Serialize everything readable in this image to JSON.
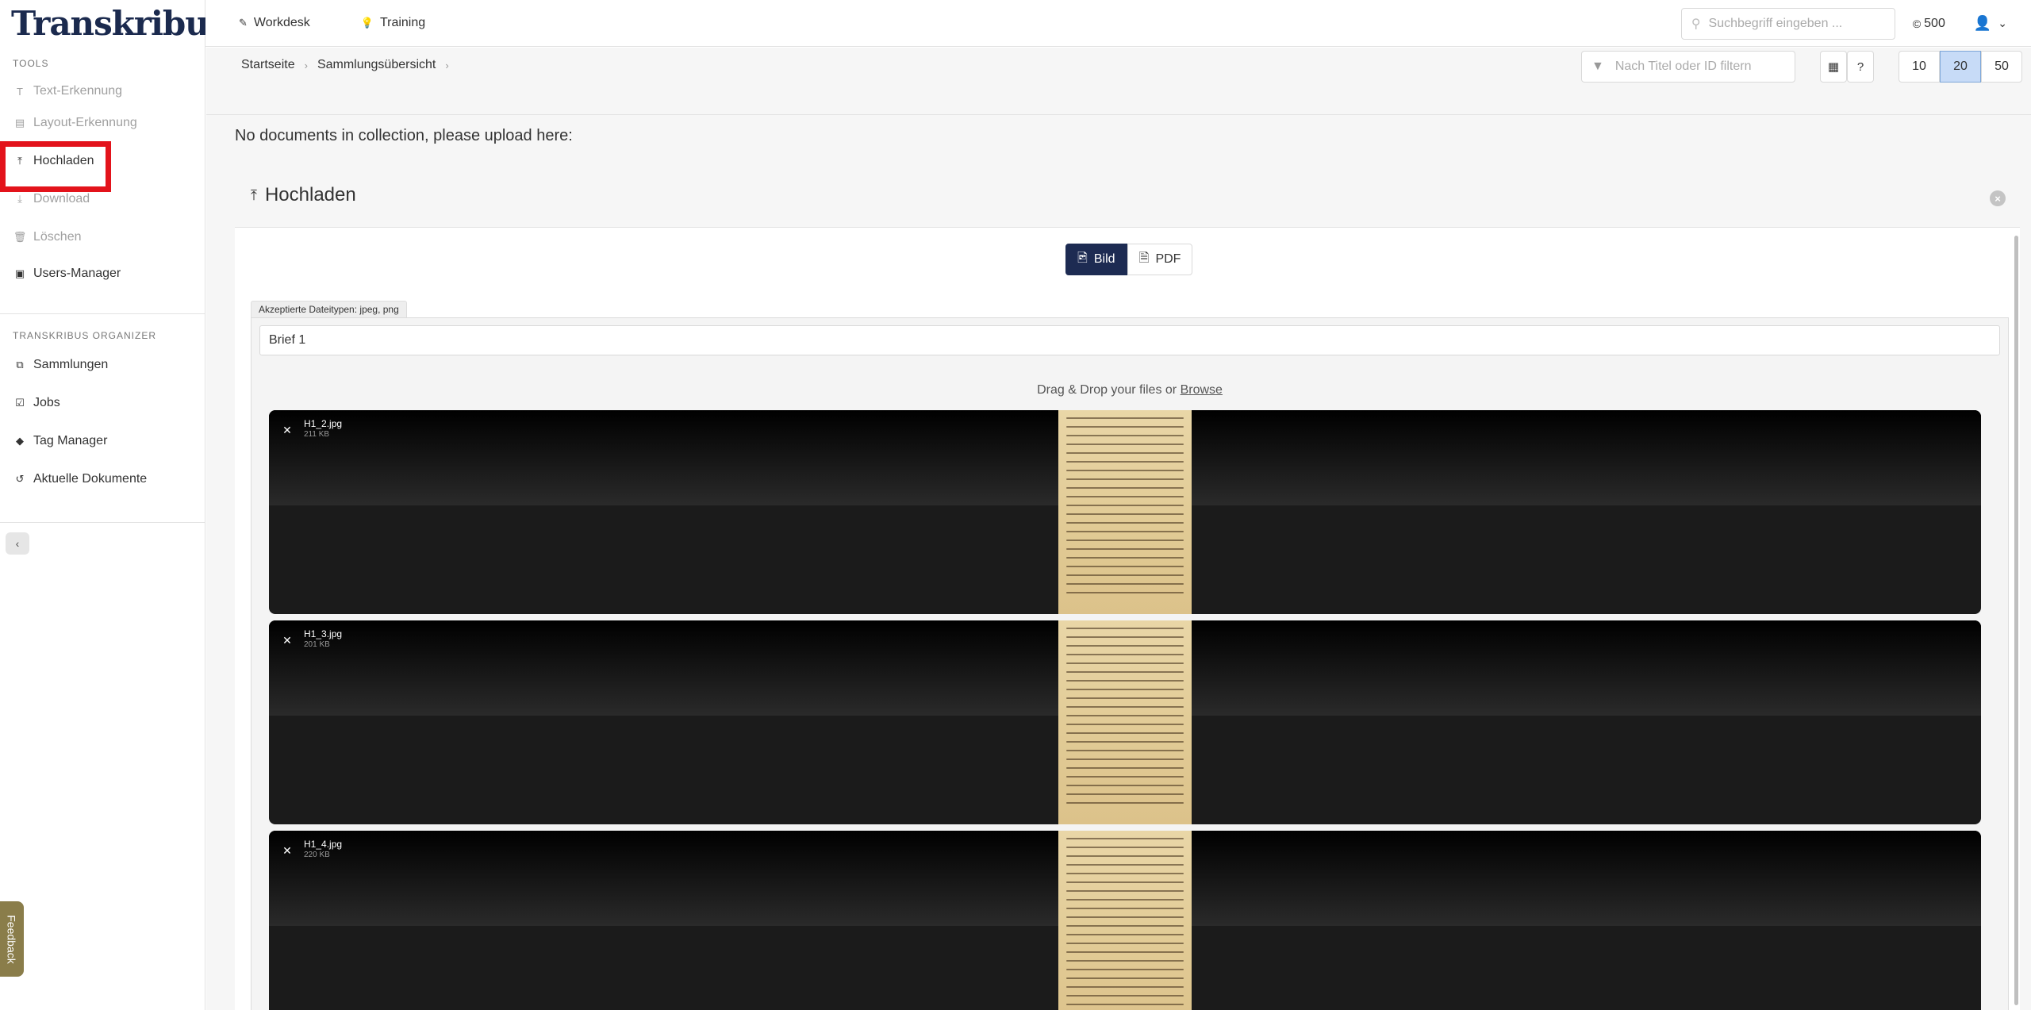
{
  "brand": {
    "name": "Transkribus",
    "mark": "®"
  },
  "sidebar": {
    "tools_title": "TOOLS",
    "tools": [
      {
        "label": "Text-Erkennung",
        "icon": "text-icon",
        "disabled": true
      },
      {
        "label": "Layout-Erkennung",
        "icon": "layout-icon",
        "disabled": true
      },
      {
        "label": "Hochladen",
        "icon": "upload-icon",
        "disabled": false,
        "highlighted": true
      },
      {
        "label": "Download",
        "icon": "download-icon",
        "disabled": true
      },
      {
        "label": "Löschen",
        "icon": "trash-icon",
        "disabled": true
      },
      {
        "label": "Users-Manager",
        "icon": "users-icon",
        "disabled": false
      }
    ],
    "organizer_title": "TRANSKRIBUS ORGANIZER",
    "organizer": [
      {
        "label": "Sammlungen",
        "icon": "collections-icon"
      },
      {
        "label": "Jobs",
        "icon": "jobs-icon"
      },
      {
        "label": "Tag Manager",
        "icon": "tag-icon"
      },
      {
        "label": "Aktuelle Dokumente",
        "icon": "history-icon"
      }
    ],
    "collapse_icon": "‹",
    "feedback_label": "Feedback"
  },
  "topbar": {
    "workdesk": "Workdesk",
    "training": "Training",
    "search_placeholder": "Suchbegriff eingeben ...",
    "credits": "500"
  },
  "breadcrumb": {
    "home": "Startseite",
    "collections": "Sammlungsübersicht"
  },
  "filter": {
    "placeholder": "Nach Titel oder ID filtern",
    "help": "?"
  },
  "page_sizes": [
    "10",
    "20",
    "50"
  ],
  "page_size_selected": "20",
  "empty_message": "No documents in collection, please upload here:",
  "upload": {
    "title": "Hochladen",
    "type_image": "Bild",
    "type_pdf": "PDF",
    "accepted_types": "Akzeptierte Dateitypen: jpeg, png",
    "doc_name_value": "Brief 1",
    "dropzone_text": "Drag & Drop your files or ",
    "browse_label": "Browse",
    "files": [
      {
        "name": "H1_2.jpg",
        "size": "211 KB"
      },
      {
        "name": "H1_3.jpg",
        "size": "201 KB"
      },
      {
        "name": "H1_4.jpg",
        "size": "220 KB"
      }
    ]
  },
  "colors": {
    "brand_navy": "#1d2b52",
    "highlight_red": "#e3131b",
    "selected_blue": "#c7dbf7",
    "feedback": "#8a7d4a"
  }
}
